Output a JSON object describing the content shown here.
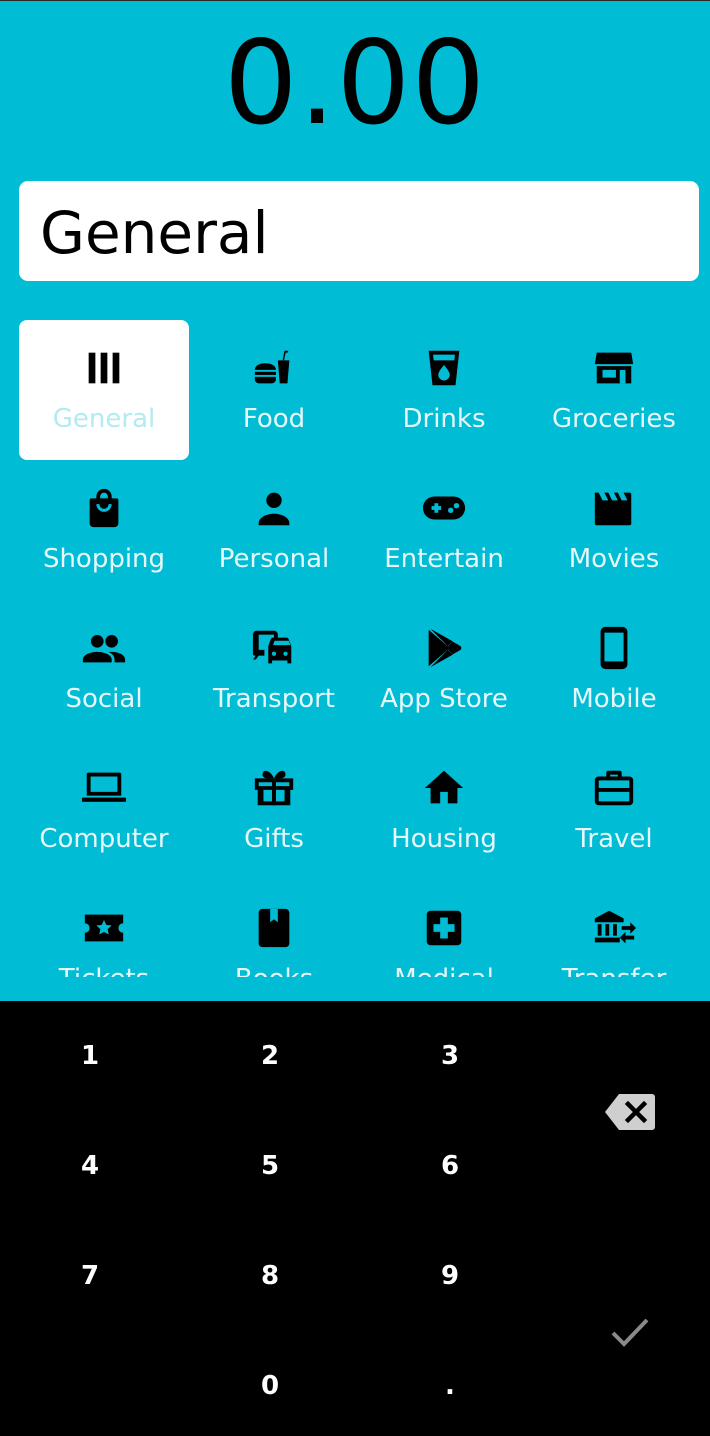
{
  "amount": {
    "value": "0.00"
  },
  "note": {
    "value": "General"
  },
  "categories": [
    {
      "label": "General",
      "icon": "bars-icon",
      "selected": true
    },
    {
      "label": "Food",
      "icon": "fastfood-icon"
    },
    {
      "label": "Drinks",
      "icon": "drink-cup-icon"
    },
    {
      "label": "Groceries",
      "icon": "store-icon"
    },
    {
      "label": "Shopping",
      "icon": "shopping-bag-icon"
    },
    {
      "label": "Personal",
      "icon": "person-icon"
    },
    {
      "label": "Entertain",
      "icon": "gamepad-icon"
    },
    {
      "label": "Movies",
      "icon": "clapperboard-icon"
    },
    {
      "label": "Social",
      "icon": "people-icon"
    },
    {
      "label": "Transport",
      "icon": "commute-icon"
    },
    {
      "label": "App Store",
      "icon": "play-store-icon"
    },
    {
      "label": "Mobile",
      "icon": "smartphone-icon"
    },
    {
      "label": "Computer",
      "icon": "laptop-icon"
    },
    {
      "label": "Gifts",
      "icon": "gift-icon"
    },
    {
      "label": "Housing",
      "icon": "home-icon"
    },
    {
      "label": "Travel",
      "icon": "suitcase-icon"
    },
    {
      "label": "Tickets",
      "icon": "ticket-icon"
    },
    {
      "label": "Books",
      "icon": "book-icon"
    },
    {
      "label": "Medical",
      "icon": "medical-cross-icon"
    },
    {
      "label": "Transfer",
      "icon": "bank-transfer-icon"
    }
  ],
  "keypad": {
    "k1": "1",
    "k2": "2",
    "k3": "3",
    "k4": "4",
    "k5": "5",
    "k6": "6",
    "k7": "7",
    "k8": "8",
    "k9": "9",
    "k0": "0",
    "dot": ".",
    "backspace_icon": "backspace-icon",
    "confirm_icon": "check-icon"
  },
  "colors": {
    "background": "#00BCD4",
    "keypad_background": "#000000",
    "selected_tile": "#FFFFFF",
    "selected_label": "#B2EBF2",
    "label": "#E6F8FB"
  }
}
